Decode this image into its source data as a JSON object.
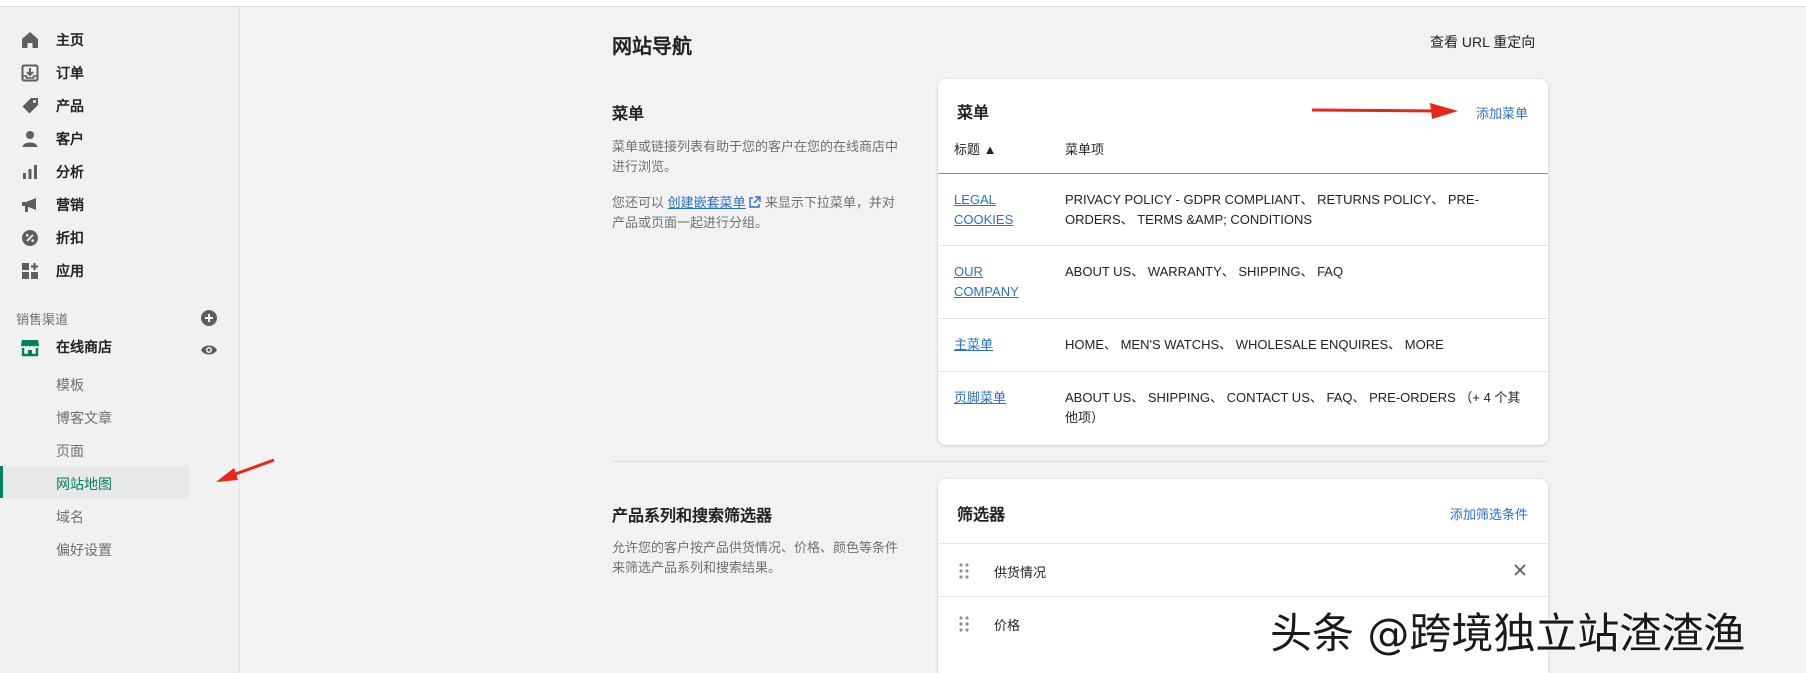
{
  "sidebar": {
    "items": [
      {
        "label": "主页",
        "icon": "home-icon"
      },
      {
        "label": "订单",
        "icon": "orders-icon"
      },
      {
        "label": "产品",
        "icon": "tag-icon"
      },
      {
        "label": "客户",
        "icon": "person-icon"
      },
      {
        "label": "分析",
        "icon": "bar-chart-icon"
      },
      {
        "label": "营销",
        "icon": "megaphone-icon"
      },
      {
        "label": "折扣",
        "icon": "discount-icon"
      },
      {
        "label": "应用",
        "icon": "apps-icon"
      }
    ],
    "section_label": "销售渠道",
    "store": {
      "label": "在线商店",
      "icon": "store-icon"
    },
    "sub_items": [
      {
        "label": "模板"
      },
      {
        "label": "博客文章"
      },
      {
        "label": "页面"
      },
      {
        "label": "网站地图",
        "active": true
      },
      {
        "label": "域名"
      },
      {
        "label": "偏好设置"
      }
    ]
  },
  "main": {
    "title": "网站导航",
    "url_redirect_link": "查看 URL 重定向",
    "menus_section": {
      "title": "菜单",
      "desc1": "菜单或链接列表有助于您的客户在您的在线商店中进行浏览。",
      "desc2_before": "您还可以",
      "desc2_link": "创建嵌套菜单",
      "desc2_after": "来显示下拉菜单，并对产品或页面一起进行分组。"
    },
    "menus_card": {
      "title": "菜单",
      "add_action": "添加菜单",
      "col_title": "标题 ▲",
      "col_items": "菜单项",
      "rows": [
        {
          "title": "LEGAL COOKIES",
          "items": "PRIVACY POLICY - GDPR COMPLIANT、 RETURNS POLICY、 PRE-ORDERS、 TERMS &AMP; CONDITIONS"
        },
        {
          "title": "OUR COMPANY",
          "items": "ABOUT US、 WARRANTY、 SHIPPING、 FAQ"
        },
        {
          "title": "主菜单",
          "items": "HOME、 MEN'S WATCHS、 WHOLESALE ENQUIRES、 MORE"
        },
        {
          "title": "页脚菜单",
          "items": "ABOUT US、 SHIPPING、 CONTACT US、 FAQ、 PRE-ORDERS （+ 4 个其他项）"
        }
      ]
    },
    "filters_section": {
      "title": "产品系列和搜索筛选器",
      "desc": "允许您的客户按产品供货情况、价格、颜色等条件来筛选产品系列和搜索结果。"
    },
    "filters_card": {
      "title": "筛选器",
      "add_action": "添加筛选条件",
      "rows": [
        {
          "label": "供货情况"
        },
        {
          "label": "价格"
        }
      ]
    }
  },
  "watermark": "头条 @跨境独立站渣渣渔",
  "colors": {
    "accent": "#008060",
    "link": "#2c6ecb",
    "annotation_arrow": "#e8271b"
  }
}
